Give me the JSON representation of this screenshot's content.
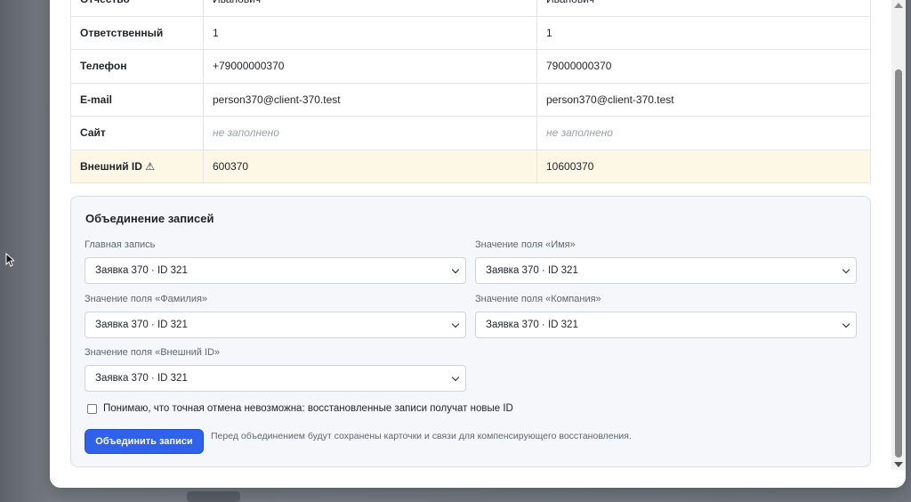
{
  "compare_rows": [
    {
      "label": "Отчество",
      "left": "Иванович",
      "right": "Иванович",
      "empty": false,
      "warn": false
    },
    {
      "label": "Ответственный",
      "left": "1",
      "right": "1",
      "empty": false,
      "warn": false
    },
    {
      "label": "Телефон",
      "left": "+79000000370",
      "right": "79000000370",
      "empty": false,
      "warn": false
    },
    {
      "label": "E-mail",
      "left": "person370@client-370.test",
      "right": "person370@client-370.test",
      "empty": false,
      "warn": false
    },
    {
      "label": "Сайт",
      "left": "не заполнено",
      "right": "не заполнено",
      "empty": true,
      "warn": false
    },
    {
      "label": "Внешний ID ⚠",
      "left": "600370",
      "right": "10600370",
      "empty": false,
      "warn": true
    }
  ],
  "merge": {
    "title": "Объединение записей",
    "fields": [
      {
        "label": "Главная запись",
        "value": "Заявка 370 · ID 321"
      },
      {
        "label": "Значение поля «Имя»",
        "value": "Заявка 370 · ID 321"
      },
      {
        "label": "Значение поля «Фамилия»",
        "value": "Заявка 370 · ID 321"
      },
      {
        "label": "Значение поля «Компания»",
        "value": "Заявка 370 · ID 321"
      },
      {
        "label": "Значение поля «Внешний ID»",
        "value": "Заявка 370 · ID 321"
      }
    ],
    "confirm_label": "Понимаю, что точная отмена невозможна: восстановленные записи получат новые ID",
    "confirm_checked": false,
    "button_label": "Объединить записи",
    "hint": "Перед объединением будут сохранены карточки и связи для компенсирующего восстановления."
  },
  "icons": {
    "warning": "warning-icon",
    "cursor": "mouse-pointer-icon",
    "select": "chevron-down-icon"
  },
  "colors": {
    "primary_button": "#2f62e9",
    "warn_row": "#fdf7e6",
    "panel_bg": "#f5f7fb"
  }
}
